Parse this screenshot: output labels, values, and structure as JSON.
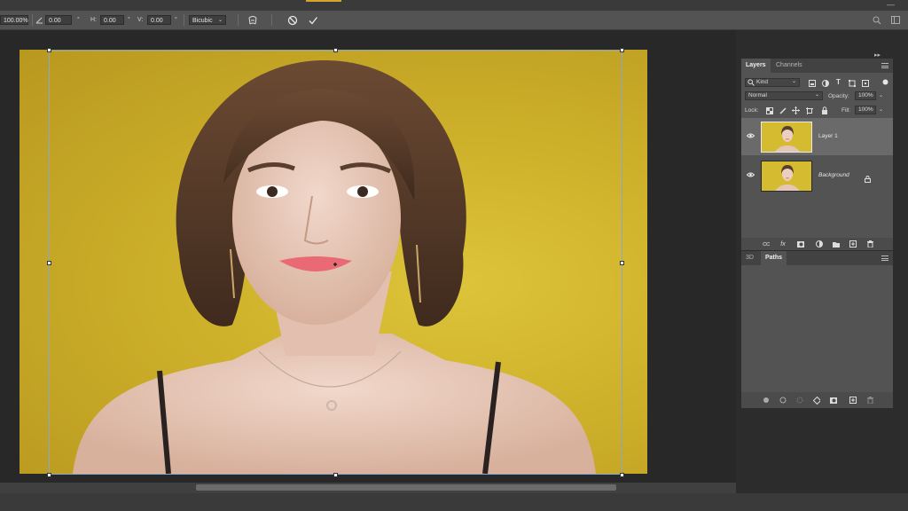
{
  "options_bar": {
    "width_value": "100.00%",
    "angle_value": "0.00",
    "h_label": "H:",
    "h_value": "0.00",
    "v_label": "V:",
    "v_value": "0.00",
    "interpolation": "Bicubic"
  },
  "layers_panel": {
    "tabs": [
      "Layers",
      "Channels"
    ],
    "filter_kind": "Kind",
    "blend_mode": "Normal",
    "opacity_label": "Opacity:",
    "opacity_value": "100%",
    "lock_label": "Lock:",
    "fill_label": "Fill:",
    "fill_value": "100%",
    "layers": [
      {
        "name": "Layer 1",
        "selected": true
      },
      {
        "name": "Background",
        "selected": false,
        "locked": true
      }
    ]
  },
  "paths_panel": {
    "tabs": [
      "3D",
      "Paths"
    ]
  },
  "colors": {
    "canvas_bg": "#282828",
    "panel_bg": "#535353",
    "photo_yellow": "#cfb22b",
    "transform_line": "#8aa6c8"
  }
}
